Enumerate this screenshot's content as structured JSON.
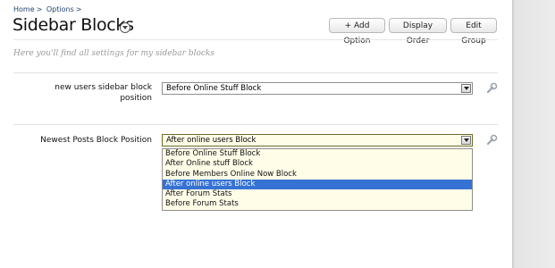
{
  "breadcrumb": {
    "items": [
      "Home",
      "Options"
    ],
    "separator": ">"
  },
  "page": {
    "title": "Sidebar Blocks",
    "subtitle": "Here you'll find all settings for my sidebar blocks"
  },
  "toolbar": {
    "add_option": "+ Add Option",
    "display_order": "Display Order",
    "edit_group": "Edit Group"
  },
  "settings": [
    {
      "label_line1": "new users sidebar block",
      "label_line2": "position",
      "value": "Before Online Stuff Block"
    },
    {
      "label_line1": "Newest Posts Block Position",
      "label_line2": "",
      "value": "After online users Block"
    }
  ],
  "dropdown": {
    "options": [
      "Before Online Stuff Block",
      "After Online stuff Block",
      "Before Members Online Now Block",
      "After online users Block",
      "After Forum Stats",
      "Before Forum Stats"
    ],
    "selected_index": 3
  },
  "colors": {
    "link": "#22436d",
    "highlight": "#3572d4",
    "dropdown_bg": "#fffde8"
  }
}
